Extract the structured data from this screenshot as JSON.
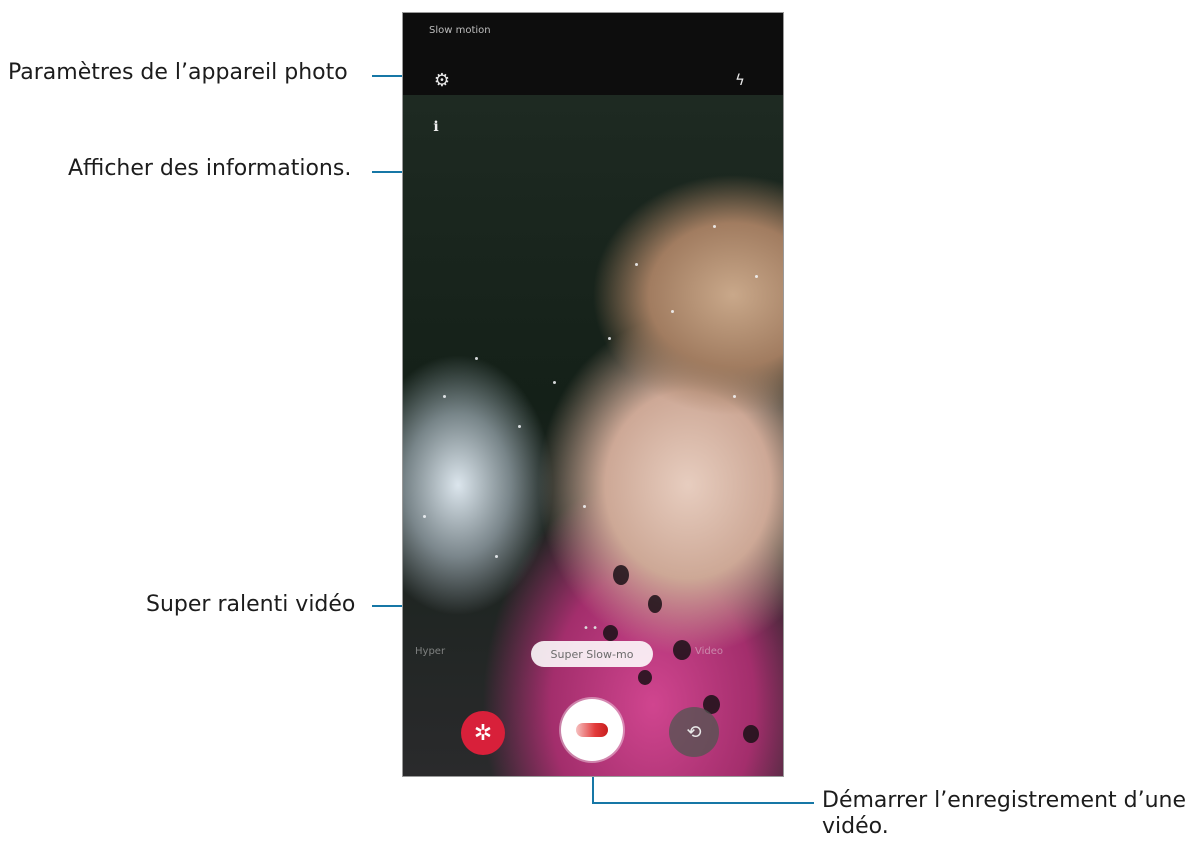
{
  "callouts": {
    "settings": "Paramètres de l’appareil photo",
    "info": "Afficher des informations.",
    "super_slow": "Super ralenti vidéo",
    "record_line1": "Démarrer l’enregistrement d’une",
    "record_line2": "vidéo."
  },
  "screen": {
    "mode_title": "Slow motion",
    "mode_pill_label": "Super Slow-mo",
    "pill_indicator": "• •",
    "mode_left": "Hyper",
    "mode_right": "Video",
    "icons": {
      "settings": "gear-icon",
      "flash": "flash-icon",
      "info": "info-icon",
      "effect": "effect-icon",
      "record": "record-icon",
      "switch_camera": "switch-camera-icon"
    }
  },
  "colors": {
    "callout_line": "#1677a6",
    "effect_button": "#d8203a",
    "record_dot": "#e23a3a"
  }
}
